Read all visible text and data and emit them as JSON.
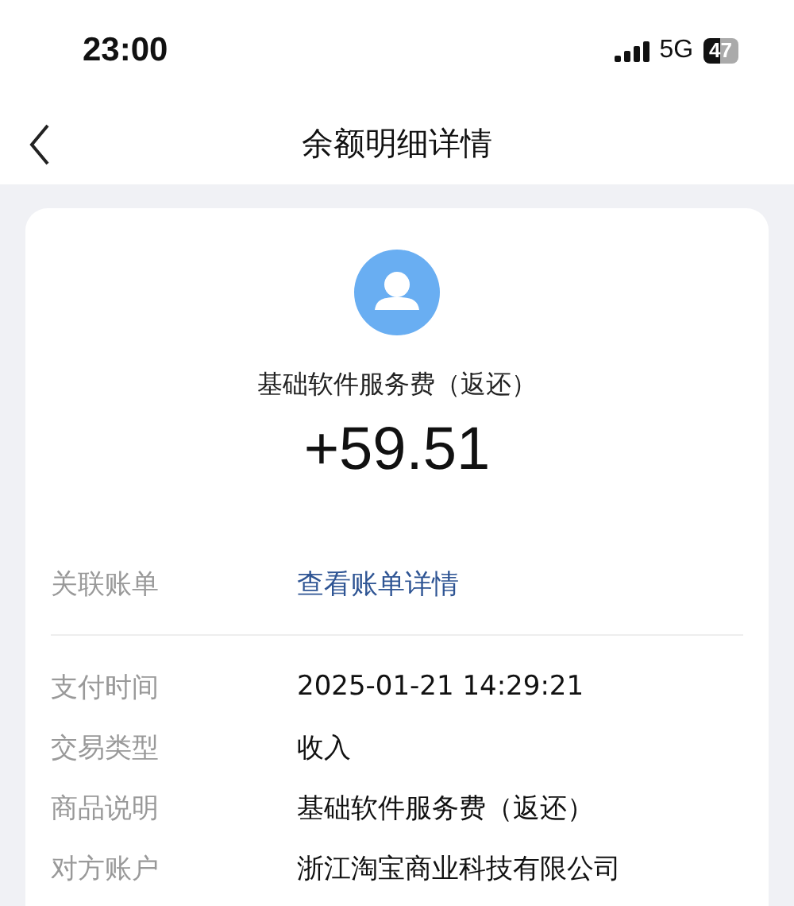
{
  "status_bar": {
    "time": "23:00",
    "network": "5G",
    "battery": "47"
  },
  "nav": {
    "title": "余额明细详情"
  },
  "summary": {
    "name": "基础软件服务费（返还）",
    "amount": "+59.51"
  },
  "link_row": {
    "label": "关联账单",
    "value": "查看账单详情"
  },
  "rows": [
    {
      "label": "支付时间",
      "value": "2025-01-21 14:29:21"
    },
    {
      "label": "交易类型",
      "value": "收入"
    },
    {
      "label": "商品说明",
      "value": "基础软件服务费（返还）"
    },
    {
      "label": "对方账户",
      "value": "浙江淘宝商业科技有限公司"
    }
  ]
}
